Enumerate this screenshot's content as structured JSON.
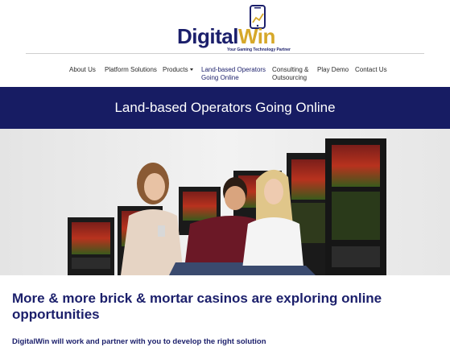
{
  "logo": {
    "brand_part1": "Digital",
    "brand_part2": "Win",
    "tagline": "Your Gaming Technology Partner",
    "brand_color": "#1b1f6b",
    "accent_color": "#d6a82a",
    "icon": "phone-icon"
  },
  "nav": {
    "items": [
      {
        "label": "About Us"
      },
      {
        "label": "Platform Solutions"
      },
      {
        "label": "Products"
      },
      {
        "label_line1": "Land-based Operators",
        "label_line2": "Going Online",
        "active": true
      },
      {
        "label_line1": "Consulting &",
        "label_line2": "Outsourcing"
      },
      {
        "label": "Play Demo"
      },
      {
        "label": "Contact Us"
      }
    ]
  },
  "banner": {
    "title": "Land-based Operators Going Online",
    "background": "#171c63"
  },
  "hero": {
    "image": "people-with-phones-and-slot-machines"
  },
  "content": {
    "heading": "More & more brick & mortar casinos are exploring online opportunities",
    "subtext": "DigitalWin will work and partner with you to develop the right solution"
  }
}
